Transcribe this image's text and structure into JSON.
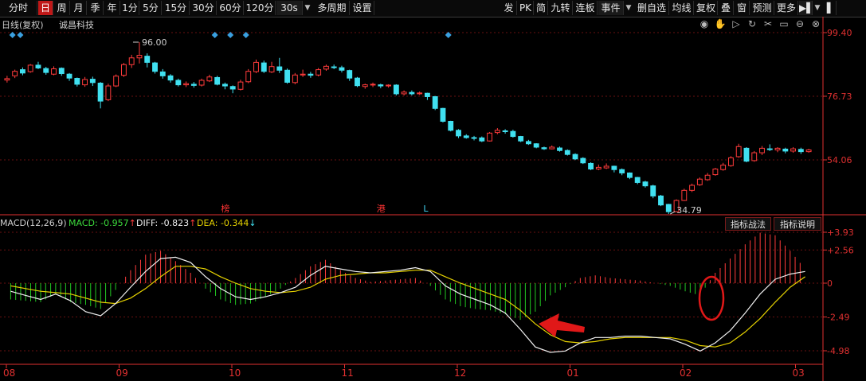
{
  "toolbar": {
    "left": [
      {
        "key": "fenshi",
        "label": "分时",
        "x": 0,
        "w": 47
      },
      {
        "key": "ri",
        "label": "日",
        "x": 48,
        "w": 19,
        "active": true
      },
      {
        "key": "zhou",
        "label": "周",
        "x": 68,
        "w": 20
      },
      {
        "key": "yue",
        "label": "月",
        "x": 89,
        "w": 20
      },
      {
        "key": "ji",
        "label": "季",
        "x": 110,
        "w": 20
      },
      {
        "key": "nian",
        "label": "年",
        "x": 131,
        "w": 20
      },
      {
        "key": "1fen",
        "label": "1分",
        "x": 152,
        "w": 23
      },
      {
        "key": "5fen",
        "label": "5分",
        "x": 176,
        "w": 27
      },
      {
        "key": "15fen",
        "label": "15分",
        "x": 204,
        "w": 34
      },
      {
        "key": "30fen",
        "label": "30分",
        "x": 239,
        "w": 33
      },
      {
        "key": "60fen",
        "label": "60分",
        "x": 273,
        "w": 33
      },
      {
        "key": "120fen",
        "label": "120分",
        "x": 307,
        "w": 39
      },
      {
        "key": "30s",
        "label": "30s",
        "x": 347,
        "w": 33,
        "dropdown": true
      },
      {
        "key": "duozhouqi",
        "label": "多周期",
        "x": 395,
        "w": 44
      },
      {
        "key": "shezhi",
        "label": "设置",
        "x": 440,
        "w": 30
      }
    ],
    "right": [
      {
        "key": "fa",
        "label": "发",
        "x": 629,
        "w": 20
      },
      {
        "key": "pk",
        "label": "PK",
        "x": 650,
        "w": 20
      },
      {
        "key": "jian",
        "label": "简",
        "x": 671,
        "w": 17
      },
      {
        "key": "jiuzhuan",
        "label": "九转",
        "x": 689,
        "w": 30
      },
      {
        "key": "lianban",
        "label": "连板",
        "x": 720,
        "w": 30
      },
      {
        "key": "shijian",
        "label": "事件",
        "x": 751,
        "w": 32,
        "dropdown": true
      },
      {
        "key": "shanzixuan",
        "label": "删自选",
        "x": 797,
        "w": 43
      },
      {
        "key": "junxian",
        "label": "均线",
        "x": 841,
        "w": 30
      },
      {
        "key": "fuquan",
        "label": "复权",
        "x": 872,
        "w": 29
      },
      {
        "key": "die",
        "label": "叠",
        "x": 902,
        "w": 19
      },
      {
        "key": "chuang",
        "label": "窗",
        "x": 922,
        "w": 19
      },
      {
        "key": "yuce",
        "label": "预测",
        "x": 942,
        "w": 30
      },
      {
        "key": "gengduo",
        "label": "更多",
        "x": 973,
        "w": 29
      },
      {
        "key": "shuchu",
        "label": "▶▌",
        "x": 1003,
        "w": 17,
        "dropdown": true
      },
      {
        "key": "sidebar",
        "label": "▌",
        "x": 1036,
        "w": 14
      }
    ]
  },
  "stock": {
    "title": "日线(复权)",
    "name": "诚昌科技"
  },
  "colors": {
    "up": "#ff3b3b",
    "down": "#40e0f0",
    "diff": "#f0f0f0",
    "dea": "#e6d200",
    "macd_label": "#3cdc3c",
    "red_axis": "#e03030",
    "grid": "#6a1010",
    "annotation": "#e01818"
  },
  "price_panel": {
    "ylabels": [
      {
        "v": 99.4,
        "t": "99.40"
      },
      {
        "v": 76.73,
        "t": "76.73"
      },
      {
        "v": 54.06,
        "t": "54.06"
      }
    ],
    "high_label": "96.00",
    "low_label": "34.79",
    "markers": [
      {
        "i": 1,
        "t": "榜",
        "color": "#ff3333"
      },
      {
        "i": 2,
        "t": "港",
        "color": "#ff3333"
      },
      {
        "i": 3,
        "t": "L",
        "color": "#40d0f0"
      }
    ]
  },
  "macd_panel": {
    "title": "MACD(12,26,9)",
    "macd": "MACD: -0.957",
    "diff": "DIFF: -0.823",
    "dea": "DEA: -0.344",
    "arrows": [
      "↑",
      "↑",
      "↓"
    ],
    "buttons": [
      "指标战法",
      "指标说明"
    ],
    "ylabels": [
      {
        "v": 3.93,
        "t": "+3.93"
      },
      {
        "v": 2.56,
        "t": "+2.56"
      },
      {
        "v": 0,
        "t": "0"
      },
      {
        "v": -2.49,
        "t": "-2.49"
      },
      {
        "v": -4.98,
        "t": "-4.98"
      }
    ]
  },
  "months": [
    {
      "t": "08",
      "i": 0
    },
    {
      "t": "09",
      "i": 1
    },
    {
      "t": "10",
      "i": 2
    },
    {
      "t": "11",
      "i": 3
    },
    {
      "t": "12",
      "i": 4
    },
    {
      "t": "01",
      "i": 5
    },
    {
      "t": "02",
      "i": 6
    },
    {
      "t": "03",
      "i": 7
    }
  ],
  "chart_data": {
    "type": "line",
    "title": "",
    "series": [
      {
        "name": "DIFF",
        "values": [
          -0.6,
          -0.9,
          -1.2,
          -0.8,
          -1.3,
          -2.1,
          -2.4,
          -1.5,
          -0.3,
          0.9,
          1.9,
          2.0,
          1.6,
          0.5,
          -0.4,
          -1.0,
          -1.2,
          -1.0,
          -0.7,
          -0.3,
          0.6,
          1.3,
          1.1,
          0.9,
          0.8,
          0.9,
          1.0,
          1.2,
          0.9,
          -0.2,
          -0.8,
          -1.2,
          -1.6,
          -2.2,
          -3.4,
          -4.7,
          -5.1,
          -5.0,
          -4.4,
          -4.0,
          -4.0,
          -3.9,
          -3.9,
          -4.0,
          -4.1,
          -4.5,
          -5.0,
          -4.4,
          -3.5,
          -2.2,
          -0.8,
          0.3,
          0.7,
          0.9
        ]
      },
      {
        "name": "DEA",
        "values": [
          -0.2,
          -0.4,
          -0.6,
          -0.7,
          -0.8,
          -1.1,
          -1.4,
          -1.5,
          -1.1,
          -0.4,
          0.5,
          1.3,
          1.3,
          1.1,
          0.5,
          0.0,
          -0.4,
          -0.6,
          -0.7,
          -0.6,
          -0.3,
          0.3,
          0.6,
          0.7,
          0.8,
          0.8,
          0.9,
          1.0,
          1.0,
          0.5,
          0.0,
          -0.4,
          -0.8,
          -1.2,
          -2.0,
          -3.0,
          -3.8,
          -4.3,
          -4.4,
          -4.3,
          -4.1,
          -4.0,
          -4.0,
          -4.0,
          -4.0,
          -4.2,
          -4.6,
          -4.7,
          -4.4,
          -3.6,
          -2.6,
          -1.4,
          -0.3,
          0.5
        ]
      },
      {
        "name": "MACD",
        "values": [
          -1.2,
          -1.3,
          -1.4,
          -0.8,
          -1.4,
          -1.6,
          -1.9,
          -0.5,
          1.0,
          2.2,
          2.5,
          1.7,
          0.8,
          -0.4,
          -1.2,
          -1.6,
          -1.5,
          -1.0,
          -0.4,
          0.4,
          1.3,
          1.8,
          1.0,
          0.4,
          0.1,
          0.2,
          0.3,
          0.4,
          -0.2,
          -1.2,
          -1.7,
          -1.9,
          -2.0,
          -2.3,
          -2.7,
          -2.1,
          -0.9,
          -0.3,
          0.4,
          0.6,
          0.4,
          0.3,
          0.2,
          0.0,
          -0.2,
          -0.6,
          -0.9,
          0.8,
          1.9,
          3.0,
          3.9,
          3.7,
          2.5,
          1.1
        ]
      }
    ],
    "candles": [
      [
        82.5,
        83.0,
        81.6,
        84.0
      ],
      [
        84.0,
        85.6,
        83.2,
        86.2
      ],
      [
        86.2,
        85.0,
        84.2,
        87.0
      ],
      [
        85.5,
        87.8,
        85.1,
        88.2
      ],
      [
        87.8,
        86.8,
        86.4,
        89.0
      ],
      [
        86.6,
        85.2,
        84.4,
        87.2
      ],
      [
        84.6,
        86.5,
        84.2,
        87.4
      ],
      [
        86.7,
        84.8,
        84.0,
        87.0
      ],
      [
        84.6,
        83.2,
        82.2,
        85.0
      ],
      [
        83.1,
        81.0,
        80.2,
        83.4
      ],
      [
        80.8,
        82.7,
        80.1,
        83.6
      ],
      [
        82.8,
        81.6,
        80.4,
        83.7
      ],
      [
        81.4,
        75.0,
        72.4,
        81.8
      ],
      [
        75.5,
        80.4,
        75.0,
        81.2
      ],
      [
        80.4,
        83.9,
        80.0,
        84.5
      ],
      [
        84.2,
        88.0,
        83.6,
        88.6
      ],
      [
        88.0,
        90.4,
        86.8,
        91.5
      ],
      [
        90.4,
        91.3,
        88.4,
        96.0
      ],
      [
        91.0,
        88.8,
        87.0,
        92.0
      ],
      [
        88.6,
        85.6,
        84.8,
        89.0
      ],
      [
        85.4,
        84.0,
        83.0,
        86.4
      ],
      [
        84.0,
        82.5,
        81.6,
        84.6
      ],
      [
        82.4,
        80.8,
        80.2,
        83.0
      ],
      [
        80.8,
        81.2,
        80.0,
        82.0
      ],
      [
        81.0,
        80.6,
        79.8,
        81.8
      ],
      [
        80.7,
        82.4,
        80.2,
        83.0
      ],
      [
        82.2,
        83.6,
        81.8,
        84.4
      ],
      [
        83.4,
        81.0,
        80.6,
        84.0
      ],
      [
        81.0,
        80.4,
        79.2,
        81.6
      ],
      [
        80.2,
        79.3,
        77.8,
        80.6
      ],
      [
        79.2,
        81.8,
        78.8,
        82.6
      ],
      [
        81.9,
        85.6,
        81.4,
        86.4
      ],
      [
        85.5,
        88.8,
        85.0,
        89.8
      ],
      [
        88.6,
        85.6,
        85.0,
        89.4
      ],
      [
        85.4,
        87.3,
        85.0,
        89.0
      ],
      [
        87.2,
        86.0,
        85.0,
        90.4
      ],
      [
        86.0,
        81.7,
        81.2,
        86.6
      ],
      [
        81.6,
        84.3,
        81.0,
        85.0
      ],
      [
        84.3,
        84.6,
        83.6,
        86.2
      ],
      [
        84.6,
        84.2,
        83.3,
        85.4
      ],
      [
        84.3,
        86.2,
        83.8,
        86.8
      ],
      [
        86.4,
        87.4,
        85.8,
        88.0
      ],
      [
        87.2,
        87.0,
        86.4,
        88.0
      ],
      [
        86.9,
        86.0,
        85.2,
        87.6
      ],
      [
        85.9,
        83.2,
        82.2,
        86.2
      ],
      [
        83.2,
        80.5,
        80.0,
        83.6
      ],
      [
        80.2,
        80.8,
        79.4,
        81.2
      ],
      [
        80.8,
        81.0,
        80.0,
        81.6
      ],
      [
        80.8,
        80.4,
        79.6,
        81.2
      ],
      [
        80.4,
        80.7,
        79.8,
        81.0
      ],
      [
        80.7,
        77.6,
        77.0,
        81.0
      ],
      [
        77.6,
        78.2,
        77.0,
        78.8
      ],
      [
        78.1,
        77.6,
        77.0,
        78.8
      ],
      [
        77.6,
        77.9,
        77.2,
        78.4
      ],
      [
        77.8,
        76.6,
        75.4,
        78.0
      ],
      [
        76.6,
        72.4,
        71.8,
        76.8
      ],
      [
        72.4,
        67.8,
        67.4,
        72.6
      ],
      [
        67.8,
        64.6,
        64.2,
        68.0
      ],
      [
        64.6,
        62.6,
        61.8,
        65.0
      ],
      [
        62.6,
        62.0,
        61.6,
        63.2
      ],
      [
        62.0,
        61.8,
        61.0,
        62.6
      ],
      [
        61.9,
        60.8,
        60.4,
        62.4
      ],
      [
        60.8,
        63.6,
        60.6,
        64.0
      ],
      [
        63.8,
        64.6,
        63.2,
        65.4
      ],
      [
        64.4,
        64.2,
        63.4,
        65.0
      ],
      [
        64.2,
        62.4,
        62.0,
        64.8
      ],
      [
        62.4,
        60.8,
        60.4,
        62.6
      ],
      [
        60.6,
        59.8,
        59.4,
        61.2
      ],
      [
        59.8,
        58.6,
        58.2,
        60.0
      ],
      [
        58.4,
        58.0,
        57.6,
        58.8
      ],
      [
        58.0,
        58.6,
        57.8,
        59.2
      ],
      [
        58.3,
        57.4,
        57.0,
        58.8
      ],
      [
        57.4,
        56.0,
        55.6,
        57.8
      ],
      [
        56.0,
        54.4,
        54.0,
        56.4
      ],
      [
        54.6,
        53.0,
        52.6,
        55.0
      ],
      [
        52.8,
        50.8,
        50.4,
        53.2
      ],
      [
        50.8,
        51.4,
        50.4,
        52.4
      ],
      [
        51.2,
        51.8,
        50.8,
        52.8
      ],
      [
        51.8,
        50.6,
        49.6,
        52.0
      ],
      [
        50.6,
        49.4,
        48.6,
        51.0
      ],
      [
        49.4,
        47.8,
        47.2,
        49.6
      ],
      [
        47.8,
        46.0,
        45.4,
        48.0
      ],
      [
        46.2,
        44.8,
        44.2,
        46.6
      ],
      [
        44.8,
        41.2,
        40.4,
        45.2
      ],
      [
        41.2,
        38.0,
        37.6,
        41.6
      ],
      [
        38.2,
        35.6,
        34.79,
        38.4
      ],
      [
        35.6,
        39.6,
        35.4,
        40.0
      ],
      [
        39.6,
        43.2,
        39.4,
        43.8
      ],
      [
        43.2,
        45.0,
        42.6,
        45.6
      ],
      [
        45.2,
        47.2,
        44.8,
        47.8
      ],
      [
        47.0,
        48.6,
        46.6,
        49.4
      ],
      [
        48.8,
        50.8,
        48.4,
        51.2
      ],
      [
        50.6,
        52.2,
        50.2,
        53.0
      ],
      [
        52.0,
        54.8,
        51.6,
        55.4
      ],
      [
        55.2,
        58.8,
        54.8,
        59.8
      ],
      [
        58.2,
        53.6,
        53.2,
        58.6
      ],
      [
        53.8,
        56.6,
        53.4,
        57.2
      ],
      [
        56.6,
        58.2,
        55.8,
        59.0
      ],
      [
        58.0,
        57.8,
        57.2,
        59.6
      ],
      [
        57.6,
        58.2,
        56.8,
        58.6
      ],
      [
        57.9,
        57.2,
        56.4,
        58.4
      ],
      [
        57.2,
        58.0,
        56.6,
        58.6
      ],
      [
        57.8,
        57.0,
        56.2,
        58.4
      ],
      [
        57.0,
        57.6,
        56.6,
        58.0
      ]
    ]
  }
}
